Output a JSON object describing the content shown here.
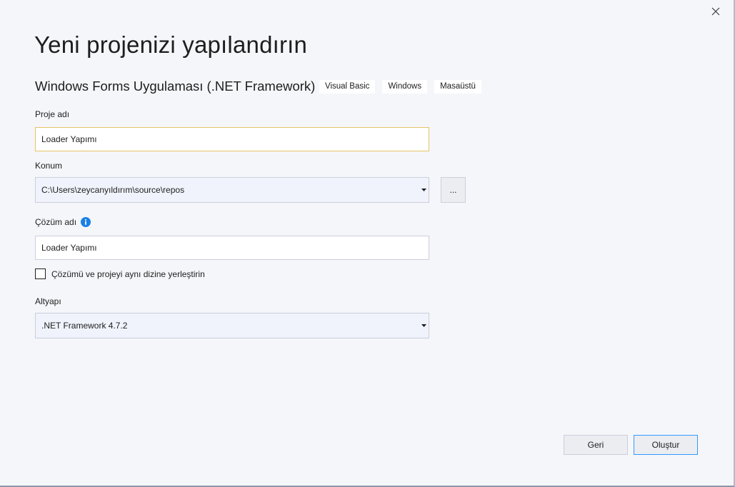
{
  "window": {
    "close_icon": "close-icon"
  },
  "page": {
    "title": "Yeni projenizi yapılandırın",
    "template_name": "Windows Forms Uygulaması (.NET Framework)",
    "tags": [
      "Visual Basic",
      "Windows",
      "Masaüstü"
    ]
  },
  "project_name": {
    "label": "Proje adı",
    "value": "Loader Yapımı"
  },
  "location": {
    "label": "Konum",
    "value": "C:\\Users\\zeycanyıldırım\\source\\repos",
    "browse_label": "..."
  },
  "solution_name": {
    "label": "Çözüm adı",
    "info_icon": "info-icon",
    "value": "Loader Yapımı"
  },
  "same_dir": {
    "label": "Çözümü ve projeyi aynı dizine yerleştirin",
    "checked": false
  },
  "framework": {
    "label": "Altyapı",
    "value": ".NET Framework 4.7.2"
  },
  "buttons": {
    "back_label": "Geri",
    "create_label": "Oluştur"
  },
  "colors": {
    "background": "#f5f6fa",
    "focus_border": "#e5c365",
    "accent": "#3399ff",
    "info": "#1b80e4"
  }
}
